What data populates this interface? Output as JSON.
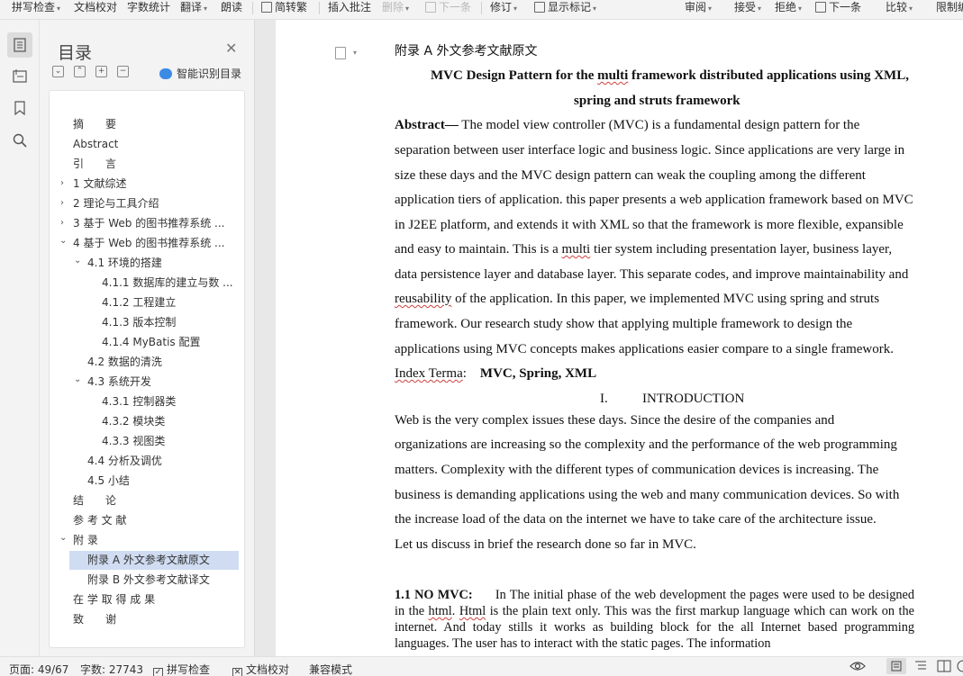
{
  "toolbar": {
    "spellcheck": "拼写检查",
    "proof": "文档校对",
    "wordcount": "字数统计",
    "translate": "翻译",
    "read": "朗读",
    "convert": "简转繁",
    "insert_comment": "插入批注",
    "delete": "删除",
    "next_comment": "下一条",
    "revise": "修订",
    "show_markup": "显示标记",
    "review": "审阅",
    "accept": "接受",
    "reject": "拒绝",
    "next_change": "下一条",
    "compare": "比较",
    "restrict": "限制编"
  },
  "toc": {
    "title": "目录",
    "smart_label": "智能识别目录",
    "items": [
      {
        "label": "摘　　要"
      },
      {
        "label": "Abstract"
      },
      {
        "label": "引　　言"
      },
      {
        "label": "1 文献综述"
      },
      {
        "label": "2 理论与工具介绍"
      },
      {
        "label": "3  基于 Web 的图书推荐系统 ..."
      },
      {
        "label": "4  基于 Web 的图书推荐系统 ..."
      },
      {
        "label": "4.1  环境的搭建"
      },
      {
        "label": "4.1.1  数据库的建立与数 ..."
      },
      {
        "label": "4.1.2  工程建立"
      },
      {
        "label": "4.1.3  版本控制"
      },
      {
        "label": "4.1.4 MyBatis 配置"
      },
      {
        "label": "4.2  数据的清洗"
      },
      {
        "label": "4.3  系统开发"
      },
      {
        "label": "4.3.1  控制器类"
      },
      {
        "label": "4.3.2  模块类"
      },
      {
        "label": "4.3.3  视图类"
      },
      {
        "label": "4.4  分析及调优"
      },
      {
        "label": "4.5  小结"
      },
      {
        "label": "结　　论"
      },
      {
        "label": "参 考 文 献"
      },
      {
        "label": "附 录"
      },
      {
        "label": "附录 A  外文参考文献原文"
      },
      {
        "label": "附录 B  外文参考文献译文"
      },
      {
        "label": "在 学 取 得 成 果"
      },
      {
        "label": "致　　谢"
      }
    ]
  },
  "document": {
    "heading": "附录 A  外文参考文献原文",
    "title_line1_a": "MVC Design Pattern for the ",
    "title_line1_sq": "multi",
    "title_line1_b": " framework distributed applications using XML,",
    "title_line2": "spring and struts framework",
    "abstract_label": "Abstract—",
    "abstract_lines": [
      " The model view controller (MVC) is a fundamental design pattern for the",
      "separation between user interface logic and business logic. Since applications are very large in",
      "size these days and the MVC design pattern can weak the coupling among the different",
      "application tiers of application. this paper presents a web application framework based on MVC",
      "in J2EE platform, and extends it with XML so that the framework is more flexible, expansible",
      "and easy to maintain. This is a ",
      " tier system including presentation layer, business layer,",
      "data persistence layer and database layer. This separate codes, and improve maintainability and",
      "reusability",
      " of the application. In this paper, we implemented MVC using spring and struts",
      "framework. Our research study show that applying multiple framework to design the",
      "applications using MVC concepts makes applications easier compare to a single framework."
    ],
    "multi": "multi",
    "index_label_sq": "Index Terma",
    "index_colon": ":",
    "index_terms": "MVC, Spring, XML",
    "section_num": "I.",
    "section_title": "INTRODUCTION",
    "intro_lines": [
      "Web is the very complex issues these days. Since the desire of the companies and",
      "organizations are increasing so the complexity and the performance of the web programming",
      "matters. Complexity with the different types of communication devices is increasing. The",
      "business is demanding applications using the web and many communication devices. So with",
      "the increase load of the data on the internet we have to take care of the architecture issue.",
      "Let us discuss in brief the research done so far in MVC."
    ],
    "nomvc_label": "1.1 NO MVC:",
    "nomvc_a": "In The initial phase of the web development the pages were used to be designed in the ",
    "nomvc_html1": "html",
    "nomvc_b": ". ",
    "nomvc_html2": "Html",
    "nomvc_c": " is the plain text only. This was the first markup language which can work on the internet. And today stills it works as building block for the all Internet based programming languages. The user has to interact with the static pages.  The information"
  },
  "status": {
    "page": "页面: 49/67",
    "words": "字数: 27743",
    "spell": "拼写检查",
    "proof": "文档校对",
    "compat": "兼容模式"
  }
}
